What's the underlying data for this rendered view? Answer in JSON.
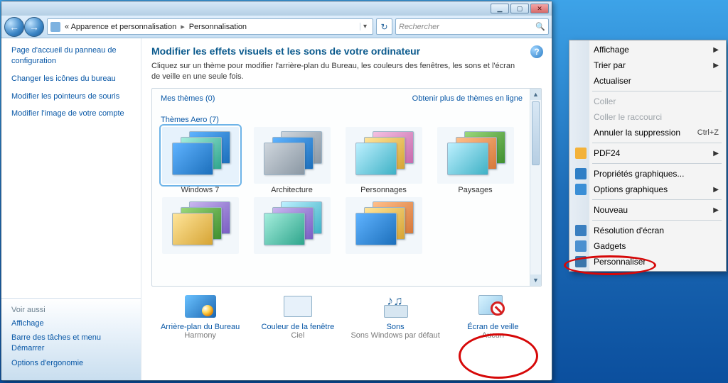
{
  "titlebar": {
    "min": "▁",
    "max": "▢",
    "close": "✕"
  },
  "nav": {
    "back": "←",
    "fwd": "→",
    "crumb1": "Apparence et personnalisation",
    "crumb2": "Personnalisation",
    "search_placeholder": "Rechercher"
  },
  "sidebar": {
    "links": [
      "Page d'accueil du panneau de configuration",
      "Changer les icônes du bureau",
      "Modifier les pointeurs de souris",
      "Modifier l'image de votre compte"
    ],
    "see_also_title": "Voir aussi",
    "see_also": [
      "Affichage",
      "Barre des tâches et menu Démarrer",
      "Options d'ergonomie"
    ]
  },
  "main": {
    "heading": "Modifier les effets visuels et les sons de votre ordinateur",
    "desc": "Cliquez sur un thème pour modifier l'arrière-plan du Bureau, les couleurs des fenêtres, les sons et l'écran de veille en une seule fois.",
    "my_themes": "Mes thèmes (0)",
    "get_more": "Obtenir plus de thèmes en ligne",
    "aero_themes": "Thèmes Aero (7)",
    "themes": [
      "Windows 7",
      "Architecture",
      "Personnages",
      "Paysages"
    ]
  },
  "footer": {
    "items": [
      {
        "link": "Arrière-plan du Bureau",
        "sub": "Harmony"
      },
      {
        "link": "Couleur de la fenêtre",
        "sub": "Ciel"
      },
      {
        "link": "Sons",
        "sub": "Sons Windows par défaut"
      },
      {
        "link": "Écran de veille",
        "sub": "Aucun"
      }
    ]
  },
  "context_menu": {
    "items": [
      {
        "label": "Affichage",
        "arrow": true
      },
      {
        "label": "Trier par",
        "arrow": true
      },
      {
        "label": "Actualiser"
      },
      {
        "sep": true
      },
      {
        "label": "Coller",
        "disabled": true
      },
      {
        "label": "Coller le raccourci",
        "disabled": true
      },
      {
        "label": "Annuler la suppression",
        "shortcut": "Ctrl+Z"
      },
      {
        "sep": true
      },
      {
        "label": "PDF24",
        "icon": "pdf",
        "arrow": true
      },
      {
        "sep": true
      },
      {
        "label": "Propriétés graphiques...",
        "icon": "gfx"
      },
      {
        "label": "Options graphiques",
        "icon": "opt",
        "arrow": true
      },
      {
        "sep": true
      },
      {
        "label": "Nouveau",
        "arrow": true
      },
      {
        "sep": true
      },
      {
        "label": "Résolution d'écran",
        "icon": "res"
      },
      {
        "label": "Gadgets",
        "icon": "gad"
      },
      {
        "label": "Personnaliser",
        "icon": "per"
      }
    ]
  }
}
